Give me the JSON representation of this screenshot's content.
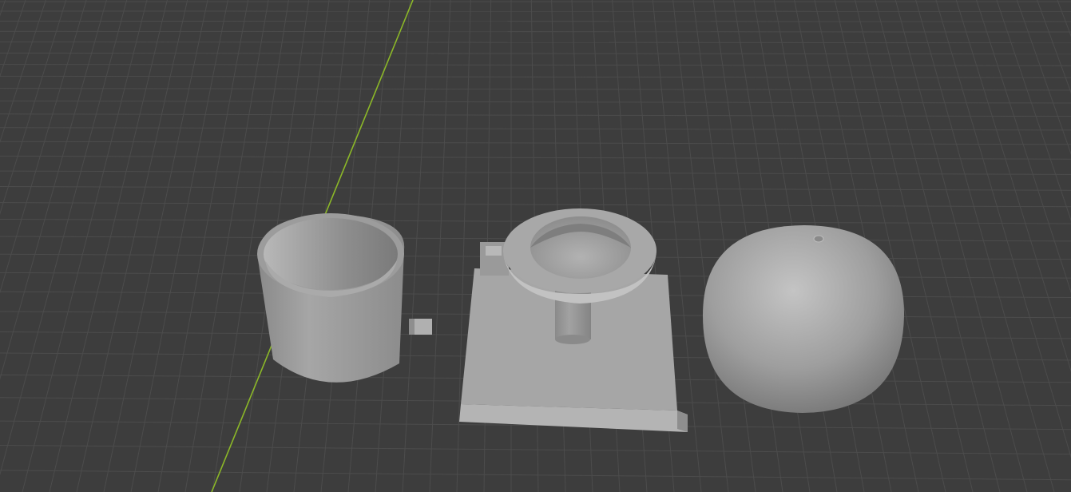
{
  "viewport": {
    "background_color": "#3d3d3d",
    "grid_color": "#4c4c4c",
    "y_axis_color": "#8cb828",
    "object_color": "#9a9a9a",
    "objects": [
      {
        "name": "hollow-cylinder",
        "description_icon": "cylinder-icon"
      },
      {
        "name": "mold-base",
        "description_icon": "cube-icon"
      },
      {
        "name": "sphere",
        "description_icon": "sphere-icon"
      }
    ],
    "text": []
  }
}
